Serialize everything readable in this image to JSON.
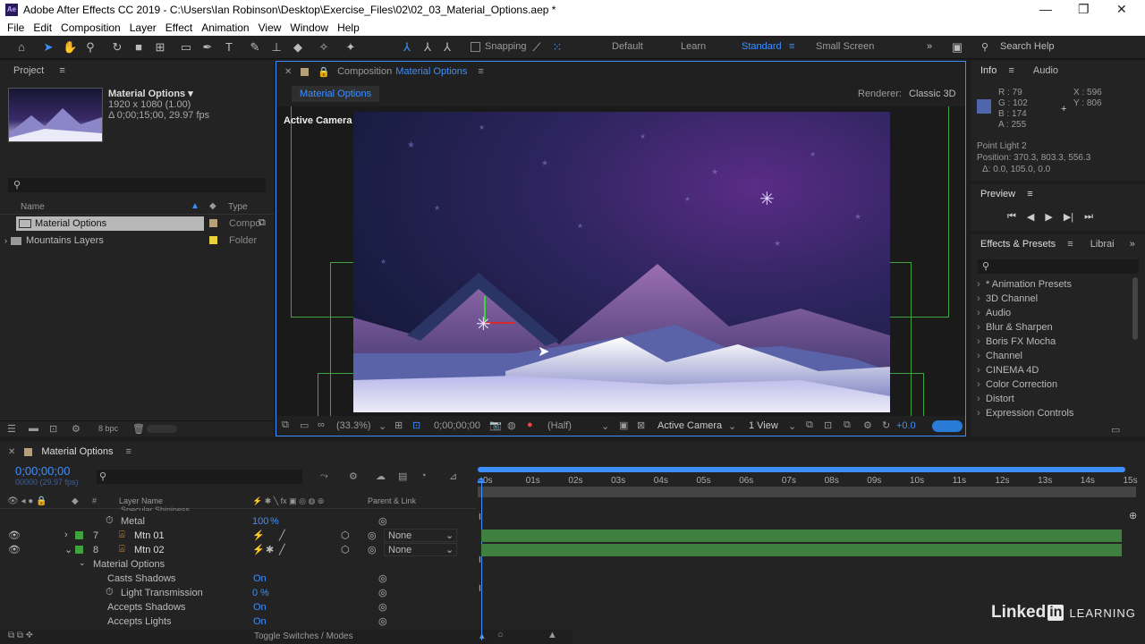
{
  "window": {
    "title": "Adobe After Effects CC 2019 - C:\\Users\\Ian Robinson\\Desktop\\Exercise_Files\\02\\02_03_Material_Options.aep *"
  },
  "menu": [
    "File",
    "Edit",
    "Composition",
    "Layer",
    "Effect",
    "Animation",
    "View",
    "Window",
    "Help"
  ],
  "toolbar": {
    "snapping": "Snapping",
    "workspaces": [
      "Default",
      "Learn",
      "Standard",
      "Small Screen"
    ],
    "active_workspace": "Standard",
    "search": "Search Help"
  },
  "project": {
    "title": "Project",
    "item_name": "Material Options",
    "item_dims": "1920 x 1080 (1.00)",
    "item_time": "Δ 0;00;15;00, 29.97 fps",
    "col_name": "Name",
    "col_type": "Type",
    "rows": [
      {
        "name": "Material Options",
        "type": "Compo"
      },
      {
        "name": "Mountains Layers",
        "type": "Folder"
      }
    ],
    "bpc": "8 bpc"
  },
  "composition": {
    "panel_label": "Composition",
    "comp_name": "Material Options",
    "tab": "Material Options",
    "renderer_label": "Renderer:",
    "renderer": "Classic 3D",
    "view_label": "Active Camera",
    "zoom": "(33.3%)",
    "timecode": "0;00;00;00",
    "resolution": "(Half)",
    "camera": "Active Camera",
    "views": "1 View",
    "exposure": "+0.0"
  },
  "info": {
    "tab": "Info",
    "tab2": "Audio",
    "r": "R : 79",
    "g": "G : 102",
    "b": "B : 174",
    "a": "A : 255",
    "x": "X : 596",
    "y": "Y : 806",
    "light": "Point Light 2",
    "position": "Position: 370.3, 803.3, 556.3",
    "delta": "Δ: 0.0, 105.0, 0.0",
    "swatch": "#4f66ae"
  },
  "preview": {
    "title": "Preview"
  },
  "effects": {
    "title": "Effects & Presets",
    "tab2": "Librai",
    "items": [
      "* Animation Presets",
      "3D Channel",
      "Audio",
      "Blur & Sharpen",
      "Boris FX Mocha",
      "Channel",
      "CINEMA 4D",
      "Color Correction",
      "Distort",
      "Expression Controls"
    ]
  },
  "timeline": {
    "tab": "Material Options",
    "timecode": "0;00;00;00",
    "fps": "00000 (29.97 fps)",
    "col_layer": "Layer Name",
    "col_parent": "Parent & Link",
    "hidden_row": "Specular Shininess",
    "metal": "Metal",
    "metal_val": "100",
    "metal_unit": "%",
    "layers": [
      {
        "num": "7",
        "name": "Mtn 01",
        "parent": "None"
      },
      {
        "num": "8",
        "name": "Mtn 02",
        "parent": "None"
      }
    ],
    "material": "Material Options",
    "props": [
      {
        "name": "Casts Shadows",
        "val": "On"
      },
      {
        "name": "Light Transmission",
        "val": "0",
        "unit": "%"
      },
      {
        "name": "Accepts Shadows",
        "val": "On"
      },
      {
        "name": "Accepts Lights",
        "val": "On"
      }
    ],
    "ticks": [
      "0s",
      "01s",
      "02s",
      "03s",
      "04s",
      "05s",
      "06s",
      "07s",
      "08s",
      "09s",
      "10s",
      "11s",
      "12s",
      "13s",
      "14s",
      "15s"
    ],
    "toggle": "Toggle Switches / Modes"
  },
  "watermark": {
    "brand1": "Linked",
    "brand2": "in",
    "brand3": "LEARNING"
  }
}
